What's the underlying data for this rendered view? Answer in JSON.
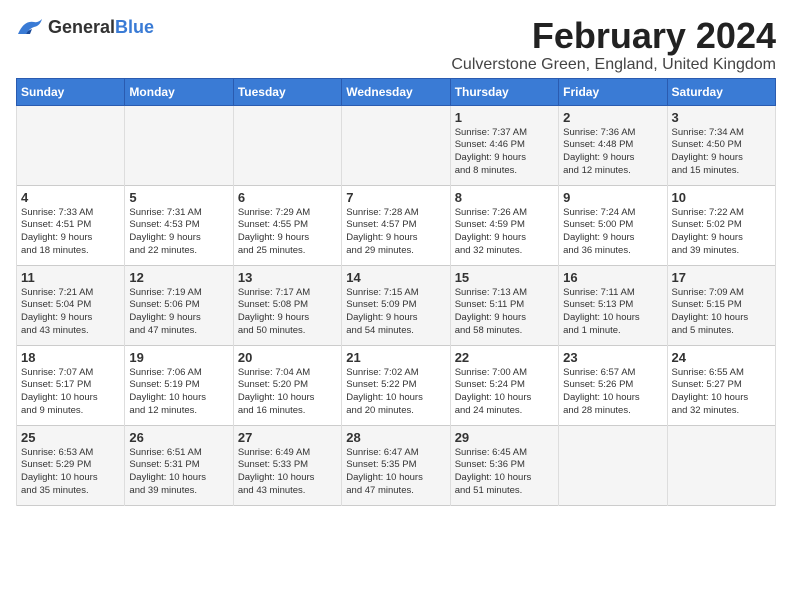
{
  "logo": {
    "text_general": "General",
    "text_blue": "Blue"
  },
  "title": "February 2024",
  "location": "Culverstone Green, England, United Kingdom",
  "weekdays": [
    "Sunday",
    "Monday",
    "Tuesday",
    "Wednesday",
    "Thursday",
    "Friday",
    "Saturday"
  ],
  "weeks": [
    [
      {
        "day": "",
        "info": ""
      },
      {
        "day": "",
        "info": ""
      },
      {
        "day": "",
        "info": ""
      },
      {
        "day": "",
        "info": ""
      },
      {
        "day": "1",
        "info": "Sunrise: 7:37 AM\nSunset: 4:46 PM\nDaylight: 9 hours\nand 8 minutes."
      },
      {
        "day": "2",
        "info": "Sunrise: 7:36 AM\nSunset: 4:48 PM\nDaylight: 9 hours\nand 12 minutes."
      },
      {
        "day": "3",
        "info": "Sunrise: 7:34 AM\nSunset: 4:50 PM\nDaylight: 9 hours\nand 15 minutes."
      }
    ],
    [
      {
        "day": "4",
        "info": "Sunrise: 7:33 AM\nSunset: 4:51 PM\nDaylight: 9 hours\nand 18 minutes."
      },
      {
        "day": "5",
        "info": "Sunrise: 7:31 AM\nSunset: 4:53 PM\nDaylight: 9 hours\nand 22 minutes."
      },
      {
        "day": "6",
        "info": "Sunrise: 7:29 AM\nSunset: 4:55 PM\nDaylight: 9 hours\nand 25 minutes."
      },
      {
        "day": "7",
        "info": "Sunrise: 7:28 AM\nSunset: 4:57 PM\nDaylight: 9 hours\nand 29 minutes."
      },
      {
        "day": "8",
        "info": "Sunrise: 7:26 AM\nSunset: 4:59 PM\nDaylight: 9 hours\nand 32 minutes."
      },
      {
        "day": "9",
        "info": "Sunrise: 7:24 AM\nSunset: 5:00 PM\nDaylight: 9 hours\nand 36 minutes."
      },
      {
        "day": "10",
        "info": "Sunrise: 7:22 AM\nSunset: 5:02 PM\nDaylight: 9 hours\nand 39 minutes."
      }
    ],
    [
      {
        "day": "11",
        "info": "Sunrise: 7:21 AM\nSunset: 5:04 PM\nDaylight: 9 hours\nand 43 minutes."
      },
      {
        "day": "12",
        "info": "Sunrise: 7:19 AM\nSunset: 5:06 PM\nDaylight: 9 hours\nand 47 minutes."
      },
      {
        "day": "13",
        "info": "Sunrise: 7:17 AM\nSunset: 5:08 PM\nDaylight: 9 hours\nand 50 minutes."
      },
      {
        "day": "14",
        "info": "Sunrise: 7:15 AM\nSunset: 5:09 PM\nDaylight: 9 hours\nand 54 minutes."
      },
      {
        "day": "15",
        "info": "Sunrise: 7:13 AM\nSunset: 5:11 PM\nDaylight: 9 hours\nand 58 minutes."
      },
      {
        "day": "16",
        "info": "Sunrise: 7:11 AM\nSunset: 5:13 PM\nDaylight: 10 hours\nand 1 minute."
      },
      {
        "day": "17",
        "info": "Sunrise: 7:09 AM\nSunset: 5:15 PM\nDaylight: 10 hours\nand 5 minutes."
      }
    ],
    [
      {
        "day": "18",
        "info": "Sunrise: 7:07 AM\nSunset: 5:17 PM\nDaylight: 10 hours\nand 9 minutes."
      },
      {
        "day": "19",
        "info": "Sunrise: 7:06 AM\nSunset: 5:19 PM\nDaylight: 10 hours\nand 12 minutes."
      },
      {
        "day": "20",
        "info": "Sunrise: 7:04 AM\nSunset: 5:20 PM\nDaylight: 10 hours\nand 16 minutes."
      },
      {
        "day": "21",
        "info": "Sunrise: 7:02 AM\nSunset: 5:22 PM\nDaylight: 10 hours\nand 20 minutes."
      },
      {
        "day": "22",
        "info": "Sunrise: 7:00 AM\nSunset: 5:24 PM\nDaylight: 10 hours\nand 24 minutes."
      },
      {
        "day": "23",
        "info": "Sunrise: 6:57 AM\nSunset: 5:26 PM\nDaylight: 10 hours\nand 28 minutes."
      },
      {
        "day": "24",
        "info": "Sunrise: 6:55 AM\nSunset: 5:27 PM\nDaylight: 10 hours\nand 32 minutes."
      }
    ],
    [
      {
        "day": "25",
        "info": "Sunrise: 6:53 AM\nSunset: 5:29 PM\nDaylight: 10 hours\nand 35 minutes."
      },
      {
        "day": "26",
        "info": "Sunrise: 6:51 AM\nSunset: 5:31 PM\nDaylight: 10 hours\nand 39 minutes."
      },
      {
        "day": "27",
        "info": "Sunrise: 6:49 AM\nSunset: 5:33 PM\nDaylight: 10 hours\nand 43 minutes."
      },
      {
        "day": "28",
        "info": "Sunrise: 6:47 AM\nSunset: 5:35 PM\nDaylight: 10 hours\nand 47 minutes."
      },
      {
        "day": "29",
        "info": "Sunrise: 6:45 AM\nSunset: 5:36 PM\nDaylight: 10 hours\nand 51 minutes."
      },
      {
        "day": "",
        "info": ""
      },
      {
        "day": "",
        "info": ""
      }
    ]
  ]
}
